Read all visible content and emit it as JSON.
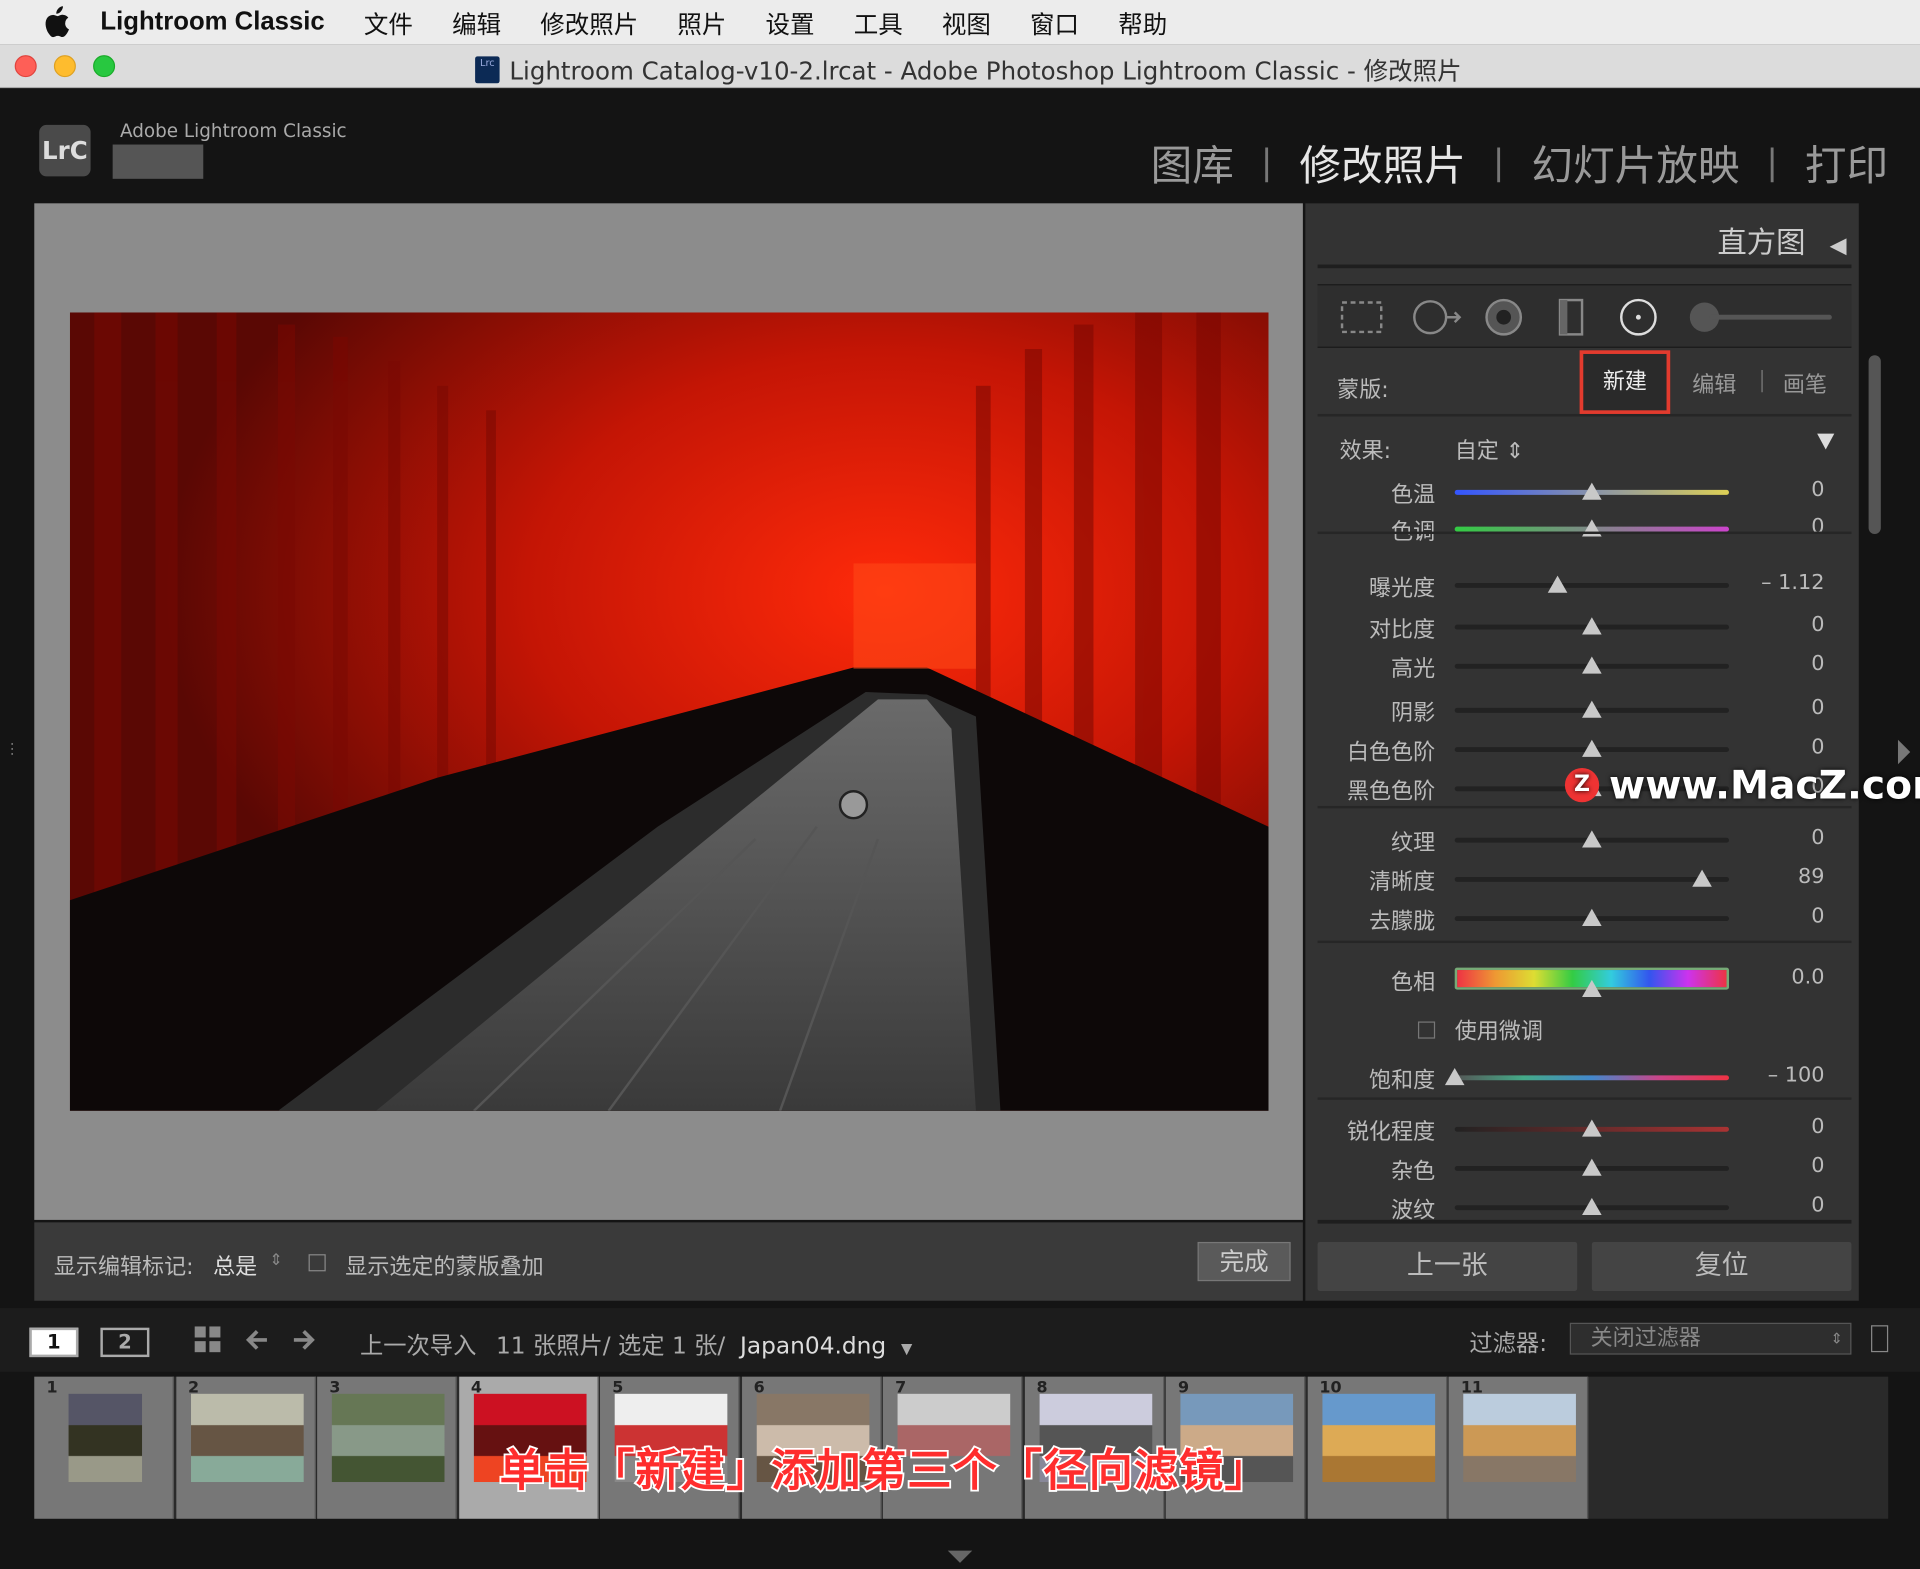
{
  "menubar": {
    "app": "Lightroom Classic",
    "items": [
      "文件",
      "编辑",
      "修改照片",
      "照片",
      "设置",
      "工具",
      "视图",
      "窗口",
      "帮助"
    ]
  },
  "window": {
    "title": "Lightroom Catalog-v10-2.lrcat - Adobe Photoshop Lightroom Classic - 修改照片",
    "doc_icon": "Lrc"
  },
  "header": {
    "logo": "LrC",
    "brand": "Adobe Lightroom Classic",
    "modules": [
      "图库",
      "修改照片",
      "幻灯片放映",
      "打印"
    ],
    "active_module": "修改照片"
  },
  "viewer_toolbar": {
    "show_marks_label": "显示编辑标记:",
    "show_marks_value": "总是",
    "overlay_label": "显示选定的蒙版叠加",
    "done_label": "完成"
  },
  "panel": {
    "histogram_label": "直方图",
    "tools": [
      "crop-icon",
      "spot-removal-icon",
      "red-eye-icon",
      "graduated-filter-icon",
      "radial-filter-icon",
      "brush-slider-icon"
    ],
    "mask_label": "蒙版:",
    "mask_new": "新建",
    "mask_edit": "编辑",
    "mask_brush": "画笔",
    "effect_label": "效果:",
    "effect_value": "自定 ⇕",
    "sliders": [
      {
        "label": "色温",
        "value": "0",
        "pos": 0.5
      },
      {
        "label": "色调",
        "value": "0",
        "pos": 0.5
      },
      {
        "label": "曝光度",
        "value": "– 1.12",
        "pos": 0.375
      },
      {
        "label": "对比度",
        "value": "0",
        "pos": 0.5
      },
      {
        "label": "高光",
        "value": "0",
        "pos": 0.5
      },
      {
        "label": "阴影",
        "value": "0",
        "pos": 0.5
      },
      {
        "label": "白色色阶",
        "value": "0",
        "pos": 0.5
      },
      {
        "label": "黑色色阶",
        "value": "0",
        "pos": 0.5
      },
      {
        "label": "纹理",
        "value": "0",
        "pos": 0.5
      },
      {
        "label": "清晰度",
        "value": "89",
        "pos": 0.9
      },
      {
        "label": "去朦胧",
        "value": "0",
        "pos": 0.5
      },
      {
        "label": "色相",
        "value": "0.0",
        "pos": 0.5
      },
      {
        "label": "饱和度",
        "value": "– 100",
        "pos": 0.0
      },
      {
        "label": "锐化程度",
        "value": "0",
        "pos": 0.5
      },
      {
        "label": "杂色",
        "value": "0",
        "pos": 0.5
      },
      {
        "label": "波纹",
        "value": "0",
        "pos": 0.5
      }
    ],
    "fine_adjust": "使用微调",
    "prev_label": "上一张",
    "reset_label": "复位"
  },
  "watermark": {
    "badge": "Z",
    "text": "www.MacZ.com"
  },
  "filmstrip_bar": {
    "page1": "1",
    "page2": "2",
    "source": "上一次导入",
    "count": "11 张照片/ 选定 1 张/",
    "file": "Japan04.dng",
    "filter_label": "过滤器:",
    "filter_value": "关闭过滤器"
  },
  "filmstrip": {
    "numbers": [
      "1",
      "2",
      "3",
      "4",
      "5",
      "6",
      "7",
      "8",
      "9",
      "10",
      "11"
    ],
    "selected": "4"
  },
  "caption": "单击「新建」添加第三个「径向滤镜」"
}
